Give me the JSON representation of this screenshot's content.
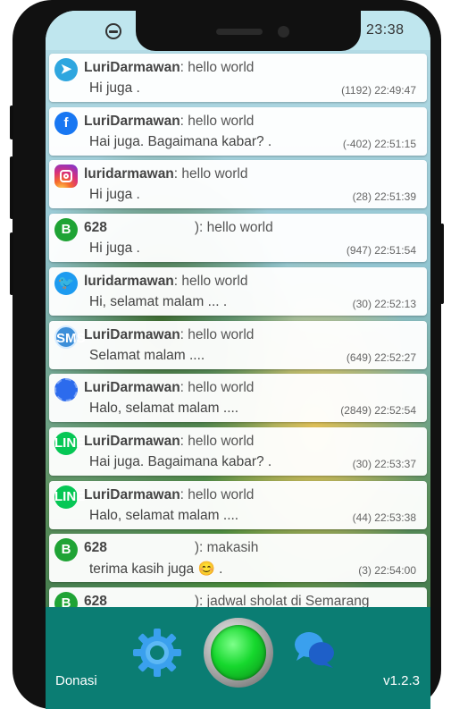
{
  "status_bar": {
    "time": "23:38",
    "left_icon": "compass-icon",
    "right_icon": "battery-icon"
  },
  "notifications": [
    {
      "app": "telegram",
      "icon": "telegram-icon",
      "sender": "LuriDarmawan",
      "title": ": hello world",
      "message": "Hi juga .",
      "count": "(1192)",
      "time": "22:49:47"
    },
    {
      "app": "facebook",
      "icon": "facebook-icon",
      "sender": "LuriDarmawan",
      "title": ": hello world",
      "message": "Hai juga. Bagaimana kabar?  .",
      "count": "(-402)",
      "time": "22:51:15"
    },
    {
      "app": "instagram",
      "icon": "instagram-icon",
      "sender": "luridarmawan",
      "title": ": hello world",
      "message": "Hi juga .",
      "count": "(28)",
      "time": "22:51:39"
    },
    {
      "app": "whatsapp-business",
      "icon": "whatsapp-business-icon",
      "sender": "628",
      "title": "): hello world",
      "message": "Hi juga .",
      "count": "(947)",
      "time": "22:51:54"
    },
    {
      "app": "twitter",
      "icon": "twitter-icon",
      "sender": "luridarmawan",
      "title": ": hello world",
      "message": "Hi, selamat malam ... .",
      "count": "(30)",
      "time": "22:52:13"
    },
    {
      "app": "sms",
      "icon": "sms-icon",
      "sender": "LuriDarmawan",
      "title": ": hello world",
      "message": "Selamat malam ....",
      "count": "(649)",
      "time": "22:52:27"
    },
    {
      "app": "signal",
      "icon": "signal-icon",
      "sender": "LuriDarmawan",
      "title": ": hello world",
      "message": "Halo, selamat malam ....",
      "count": "(2849)",
      "time": "22:52:54"
    },
    {
      "app": "line",
      "icon": "line-icon",
      "sender": "LuriDarmawan",
      "title": ": hello world",
      "message": "Hai juga. Bagaimana kabar?  .",
      "count": "(30)",
      "time": "22:53:37"
    },
    {
      "app": "line",
      "icon": "line-icon",
      "sender": "LuriDarmawan",
      "title": ": hello world",
      "message": "Halo, selamat malam ....",
      "count": "(44)",
      "time": "22:53:38"
    },
    {
      "app": "whatsapp-business",
      "icon": "whatsapp-business-icon",
      "sender": "628",
      "title": "): makasih",
      "message": "terima kasih juga 😊  .",
      "count": "(3)",
      "time": "22:54:00"
    },
    {
      "app": "whatsapp-business",
      "icon": "whatsapp-business-icon",
      "sender": "628",
      "title": "): jadwal sholat di Semarang",
      "message": "",
      "count": "",
      "time": ""
    }
  ],
  "toolbar": {
    "donate_label": "Donasi",
    "version_label": "v1.2.3",
    "settings_icon": "gear-icon",
    "power_icon": "power-button-icon",
    "chat_icon": "chat-bubbles-icon"
  },
  "colors": {
    "toolbar_bg": "#0b7d73",
    "power_on": "#16d82d",
    "gear_blue": "#3aa0ee"
  },
  "icon_glyphs": {
    "telegram": "➤",
    "facebook": "f",
    "instagram": "",
    "whatsapp-business": "B",
    "twitter": "🐦",
    "sms": "SMS",
    "signal": "",
    "line": "LINE"
  }
}
